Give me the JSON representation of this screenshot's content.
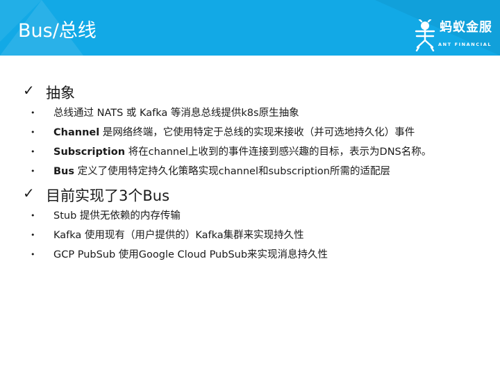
{
  "header": {
    "title": "Bus/总线",
    "logo": {
      "name": "蚂蚁金服",
      "sub": "ANT FINANCIAL",
      "icon": "ant-logo-icon"
    },
    "bg_color": "#12a9e6"
  },
  "sections": [
    {
      "title": "抽象",
      "items": [
        {
          "bold": "",
          "text": "总线通过 NATS 或 Kafka 等消息总线提供k8s原生抽象"
        },
        {
          "bold": "Channel",
          "text": " 是网络终端，它使用特定于总线的实现来接收（并可选地持久化）事件"
        },
        {
          "bold": "Subscription",
          "text": " 将在channel上收到的事件连接到感兴趣的目标，表示为DNS名称。"
        },
        {
          "bold": "Bus",
          "text": " 定义了使用特定持久化策略实现channel和subscription所需的适配层"
        }
      ]
    },
    {
      "title": "目前实现了3个Bus",
      "items": [
        {
          "bold": "",
          "text": "Stub 提供无依赖的内存传输"
        },
        {
          "bold": "",
          "text": "Kafka 使用现有（用户提供的）Kafka集群来实现持久性"
        },
        {
          "bold": "",
          "text": "GCP PubSub 使用Google Cloud PubSub来实现消息持久性"
        }
      ]
    }
  ],
  "check_glyph": "✓",
  "bullet_glyph": "•"
}
